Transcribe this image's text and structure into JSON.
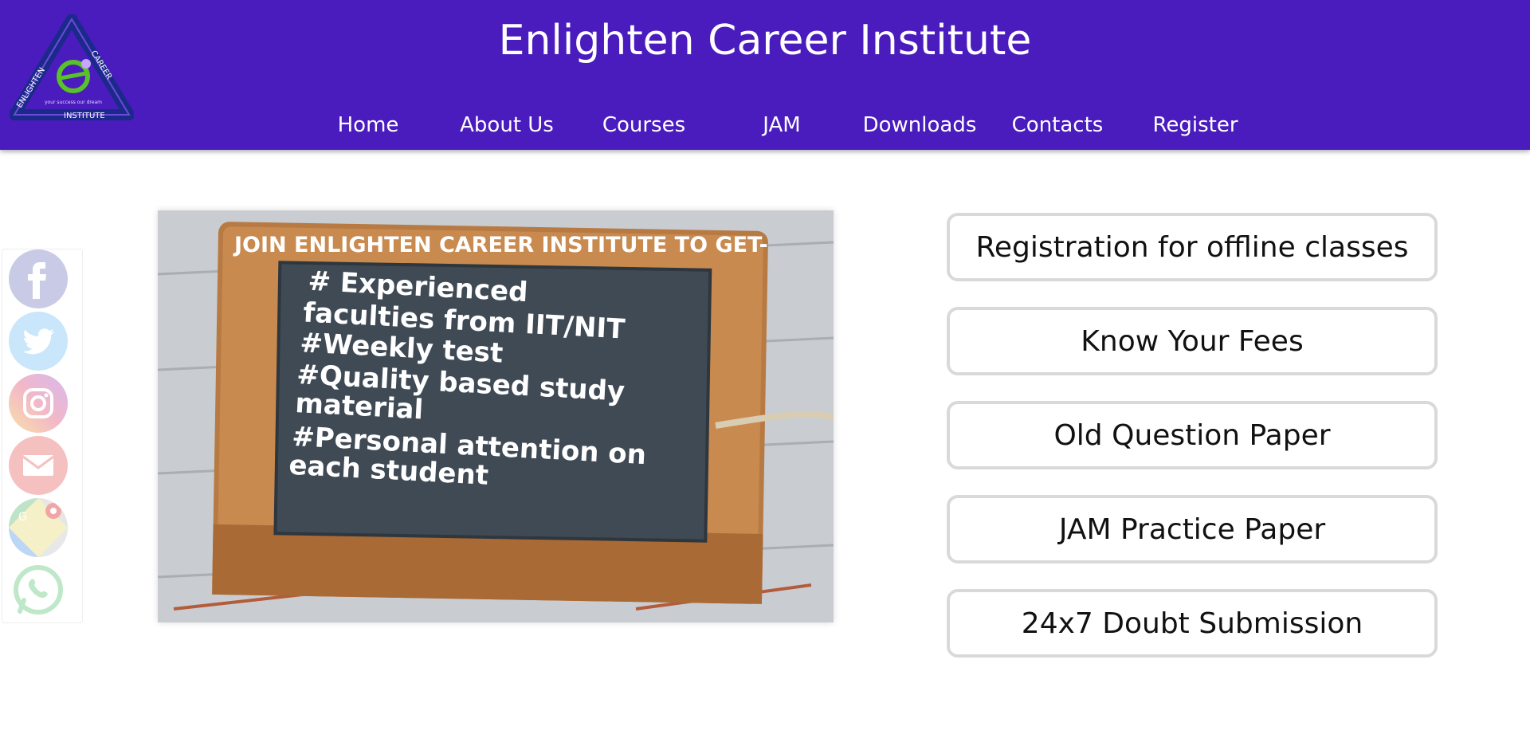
{
  "header": {
    "title": "Enlighten Career Institute",
    "logo": {
      "top_text": "CAREER",
      "left_text": "ENLIGHTEN",
      "bottom_text": "INSTITUTE",
      "tagline": "your success our dream",
      "colors": {
        "ring": "#1b2a8a",
        "e": "#59c12a",
        "star": "#c7a6ff"
      }
    }
  },
  "nav": {
    "items": [
      {
        "label": "Home"
      },
      {
        "label": "About Us"
      },
      {
        "label": "Courses"
      },
      {
        "label": "JAM"
      },
      {
        "label": "Downloads"
      },
      {
        "label": "Contacts"
      },
      {
        "label": "Register"
      }
    ]
  },
  "social": {
    "icons": [
      {
        "name": "facebook-icon",
        "color": "#3b5998"
      },
      {
        "name": "twitter-icon",
        "color": "#1da1f2"
      },
      {
        "name": "instagram-icon",
        "color": "#d6249f"
      },
      {
        "name": "email-icon",
        "color": "#ea4335"
      },
      {
        "name": "map-icon",
        "color": "#34a853"
      },
      {
        "name": "whatsapp-icon",
        "color": "#25d366"
      }
    ]
  },
  "hero": {
    "heading": "JOIN ENLIGHTEN CAREER INSTITUTE TO GET-",
    "lines": [
      "# Experienced",
      "faculties from IIT/NIT",
      "#Weekly test",
      "#Quality based study",
      "material",
      "#Personal attention on",
      "each student"
    ]
  },
  "actions": [
    {
      "label": "Registration for offline classes"
    },
    {
      "label": "Know Your Fees"
    },
    {
      "label": "Old Question Paper"
    },
    {
      "label": "JAM Practice Paper"
    },
    {
      "label": "24x7 Doubt Submission"
    }
  ],
  "colors": {
    "header_bg": "#4a1bbd",
    "button_border": "#d9d9d9"
  }
}
